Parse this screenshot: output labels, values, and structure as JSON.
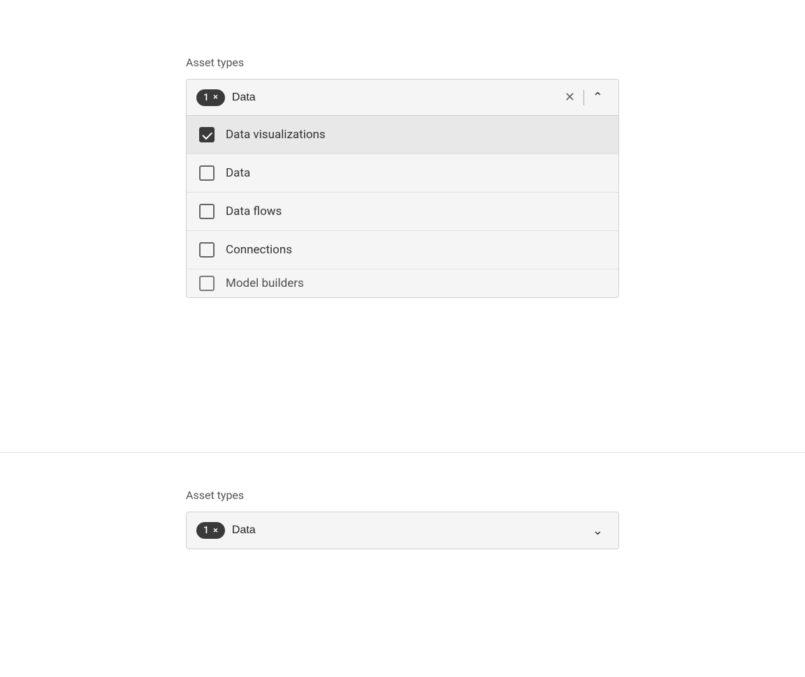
{
  "top_section": {
    "label": "Asset types",
    "badge": {
      "count": "1",
      "close_label": "×"
    },
    "search_value": "Data",
    "clear_tooltip": "Clear",
    "chevron_direction": "up",
    "items": [
      {
        "id": "data-visualizations",
        "label": "Data visualizations",
        "checked": true
      },
      {
        "id": "data",
        "label": "Data",
        "checked": false
      },
      {
        "id": "data-flows",
        "label": "Data flows",
        "checked": false
      },
      {
        "id": "connections",
        "label": "Connections",
        "checked": false
      },
      {
        "id": "model-builders",
        "label": "Model builders",
        "checked": false
      }
    ]
  },
  "bottom_section": {
    "label": "Asset types",
    "badge": {
      "count": "1",
      "close_label": "×"
    },
    "search_value": "Data",
    "chevron_direction": "down"
  },
  "colors": {
    "badge_bg": "#3a3a3a",
    "badge_text": "#ffffff",
    "selected_item_bg": "#e8e8e8",
    "border": "#d0d0d0",
    "background": "#f5f5f5"
  }
}
